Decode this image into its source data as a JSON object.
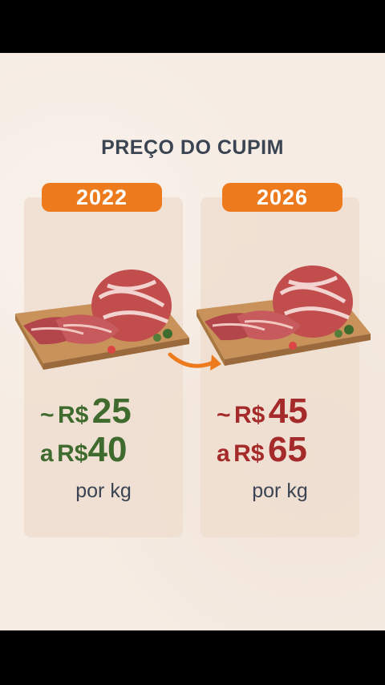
{
  "title": "PREÇO DO CUPIM",
  "colors": {
    "accent": "#ee7a1e",
    "old_price": "#3f6b2e",
    "new_price": "#a52a2a",
    "text": "#3b4452",
    "background": "#f6ece3"
  },
  "left": {
    "year": "2022",
    "prefix1": "~",
    "currency1": "R$",
    "value1": "25",
    "prefix2": "a",
    "currency2": "R$",
    "value2": "40",
    "unit": "por kg"
  },
  "right": {
    "year": "2026",
    "prefix1": "~",
    "currency1": "R$",
    "value1": "45",
    "prefix2": "a",
    "currency2": "R$",
    "value2": "65",
    "unit": "por kg"
  }
}
